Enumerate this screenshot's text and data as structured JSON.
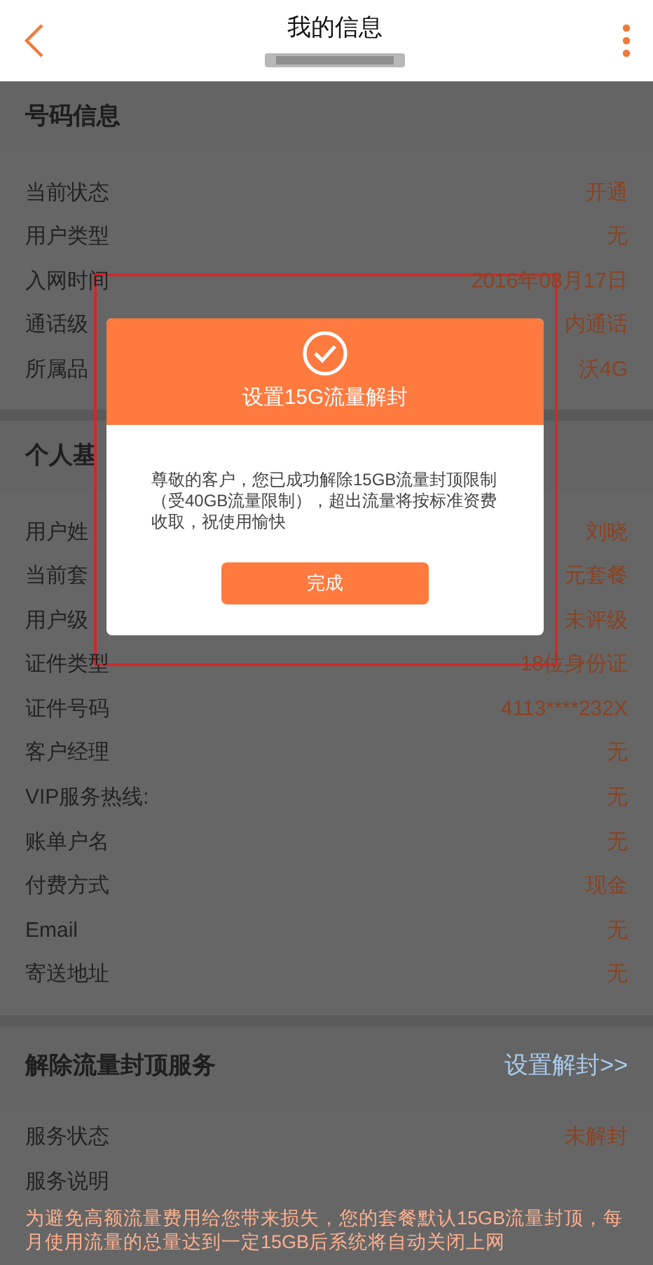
{
  "header": {
    "title": "我的信息"
  },
  "sections": [
    {
      "title": "号码信息",
      "rows": [
        {
          "label": "当前状态",
          "value": "开通"
        },
        {
          "label": "用户类型",
          "value": "无"
        },
        {
          "label": "入网时间",
          "value": "2016年08月17日"
        },
        {
          "label": "通话级",
          "value": "内通话"
        },
        {
          "label": "所属品",
          "value": "沃4G"
        }
      ]
    },
    {
      "title": "个人基",
      "rows": [
        {
          "label": "用户姓",
          "value": "刘晓"
        },
        {
          "label": "当前套",
          "value": "元套餐"
        },
        {
          "label": "用户级",
          "value": "未评级"
        },
        {
          "label": "证件类型",
          "value": "18位身份证"
        },
        {
          "label": "证件号码",
          "value": "4113****232X"
        },
        {
          "label": "客户经理",
          "value": "无"
        },
        {
          "label": "VIP服务热线:",
          "value": "无"
        },
        {
          "label": "账单户名",
          "value": "无"
        },
        {
          "label": "付费方式",
          "value": "现金"
        },
        {
          "label": "Email",
          "value": "无"
        },
        {
          "label": "寄送地址",
          "value": "无"
        }
      ]
    }
  ],
  "service": {
    "title": "解除流量封顶服务",
    "link": "设置解封>>",
    "rows": [
      {
        "label": "服务状态",
        "value": "未解封"
      },
      {
        "label": "服务说明",
        "value": ""
      }
    ],
    "note": "为避免高额流量费用给您带来损失，您的套餐默认15GB流量封顶，每月使用流量的总量达到一定15GB后系统将自动关闭上网"
  },
  "dialog": {
    "title": "设置15G流量解封",
    "message": "尊敬的客户，您已成功解除15GB流量封顶限制（受40GB流量限制），超出流量将按标准资费收取，祝使用愉快",
    "button": "完成"
  }
}
